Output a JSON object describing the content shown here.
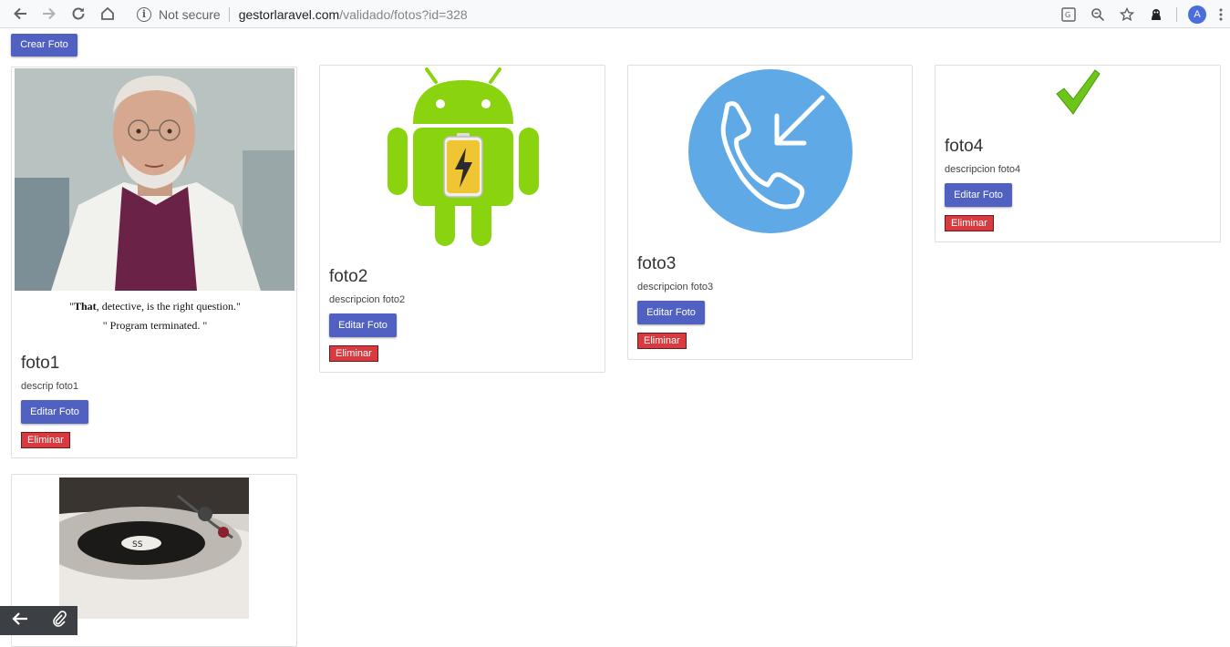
{
  "browser": {
    "security_label": "Not secure",
    "url_host": "gestorlaravel.com",
    "url_path": "/validado/fotos?id=328",
    "avatar_letter": "A"
  },
  "page": {
    "create_button": "Crear Foto"
  },
  "cards": [
    {
      "title": "foto1",
      "description": "descrip foto1",
      "edit_label": "Editar Foto",
      "delete_label": "Eliminar",
      "image_caption_line1_bold": "That",
      "image_caption_line1_rest": ", detective, is the right question.\"",
      "image_caption_line2": "\" Program terminated. \""
    },
    {
      "title": "foto2",
      "description": "descripcion foto2",
      "edit_label": "Editar Foto",
      "delete_label": "Eliminar"
    },
    {
      "title": "foto3",
      "description": "descripcion foto3",
      "edit_label": "Editar Foto",
      "delete_label": "Eliminar"
    },
    {
      "title": "foto4",
      "description": "descripcion foto4",
      "edit_label": "Editar Foto",
      "delete_label": "Eliminar"
    }
  ],
  "colors": {
    "primary_button": "#5161c2",
    "danger_button": "#d93a3f",
    "android_green": "#8ad40f",
    "phone_blue": "#5ea9e6"
  }
}
